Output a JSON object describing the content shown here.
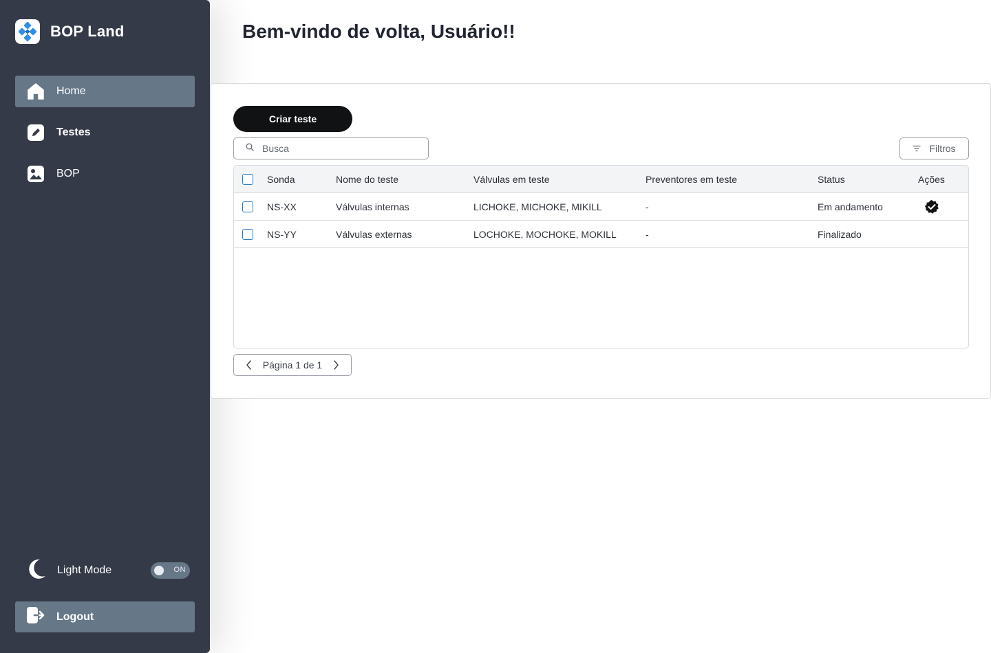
{
  "app": {
    "brand_name": "BOP Land"
  },
  "sidebar": {
    "items": [
      {
        "label": "Home",
        "icon": "home-icon",
        "active": true
      },
      {
        "label": "Testes",
        "icon": "edit-icon",
        "active": false
      },
      {
        "label": "BOP",
        "icon": "image-icon",
        "active": false
      }
    ],
    "mode": {
      "label": "Light Mode",
      "icon": "moon-icon",
      "toggle_text": "ON"
    },
    "logout_label": "Logout"
  },
  "header": {
    "title": "Bem-vindo de volta, Usuário!!"
  },
  "toolbar": {
    "create_label": "Criar teste",
    "search_placeholder": "Busca",
    "filter_label": "Filtros"
  },
  "table": {
    "columns": [
      "Sonda",
      "Nome do teste",
      "Válvulas em teste",
      "Preventores em teste",
      "Status",
      "Ações"
    ],
    "rows": [
      {
        "sonda": "NS-XX",
        "nome": "Válvulas internas",
        "valvulas": "LICHOKE, MICHOKE, MIKILL",
        "preventores": "-",
        "status": "Em andamento",
        "action_icon": "verified-badge-icon"
      },
      {
        "sonda": "NS-YY",
        "nome": "Válvulas externas",
        "valvulas": "LOCHOKE, MOCHOKE, MOKILL",
        "preventores": "-",
        "status": "Finalizado",
        "action_icon": ""
      }
    ]
  },
  "pagination": {
    "label": "Página 1 de 1"
  },
  "colors": {
    "sidebar_bg": "#343a47",
    "sidebar_active": "#667788",
    "primary_button": "#111214",
    "checkbox_border": "#2a7bc0",
    "brand_blue": "#2f8fe6"
  }
}
